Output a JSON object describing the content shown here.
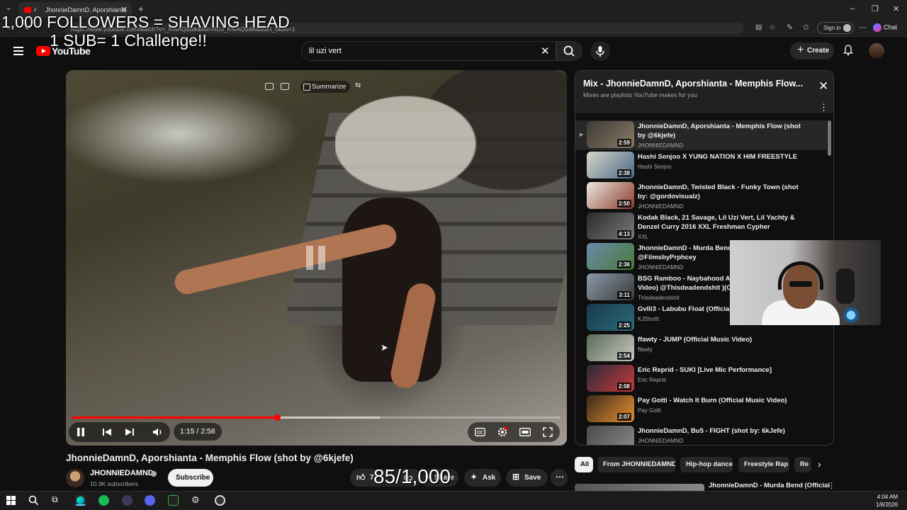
{
  "browser": {
    "tab_title": "JhonnieDamnD, Aporshianta",
    "url": "https://www.youtube.com/watch?v=_Kf4AQddik&list=RDJ_Kf4AQddik&start_radio=1",
    "sign_in": "Sign in",
    "chat": "Chat"
  },
  "stream_overlay": {
    "line1": "1,000 FOLLOWERS = SHAVING HEAD",
    "line2": "1 SUB= 1 Challenge!!",
    "counter": "85/1,000"
  },
  "header": {
    "logo_text": "YouTube",
    "search_value": "lil uzi vert",
    "create_label": "Create"
  },
  "player": {
    "summarize_label": "Summarize",
    "time": "1:15 / 2:58",
    "progress": 0.42,
    "buffered": 0.63
  },
  "video": {
    "title": "JhonnieDamnD, Aporshianta - Memphis Flow (shot by @6kjefe)",
    "channel": "JHONNIEDAMND",
    "subscribers": "10.3K subscribers",
    "subscribe_label": "Subscribe",
    "like_count": "7",
    "share_label": "Share",
    "ask_label": "Ask",
    "save_label": "Save"
  },
  "playlist": {
    "title": "Mix - JhonnieDamnD, Aporshianta - Memphis Flow...",
    "subtitle": "Mixes are playlists YouTube makes for you",
    "items": [
      {
        "title": "JhonnieDamnD, Aporshianta - Memphis Flow (shot by @6kjefe)",
        "channel": "JHONNIEDAMND",
        "duration": "2:59",
        "active": true,
        "colors": [
          "#3d3b35",
          "#8a7a66"
        ]
      },
      {
        "title": "Hashi Senjoo X YUNG NATION X HIM FREESTYLE",
        "channel": "Hashi Senjoo",
        "duration": "2:38",
        "active": false,
        "colors": [
          "#d8d4c8",
          "#4a6a8a"
        ]
      },
      {
        "title": "JhonnieDamnD, Twisted Black - Funky Town (shot by: @gordovisualz)",
        "channel": "JHONNIEDAMND",
        "duration": "2:50",
        "active": false,
        "colors": [
          "#ece8e0",
          "#8a3a2a"
        ]
      },
      {
        "title": "Kodak Black, 21 Savage, Lil Uzi Vert, Lil Yachty & Denzel Curry 2016 XXL Freshman Cypher",
        "channel": "XXL",
        "duration": "4:13",
        "active": false,
        "colors": [
          "#2a2a2a",
          "#7a7a7a"
        ]
      },
      {
        "title": "JhonnieDamnD - Murda Bend (Official Video) @FilmsbyPrphcey",
        "channel": "JHONNIEDAMND",
        "duration": "2:36",
        "active": false,
        "colors": [
          "#6a8aaa",
          "#4a7a3a"
        ]
      },
      {
        "title": "BSG Ramboo - Naybahood Anthem (Official Music Video) @Thisdeadendshit )(Official Music Video)",
        "channel": "Thisdeadendshit",
        "duration": "3:11",
        "active": false,
        "colors": [
          "#8a9aaa",
          "#3a3a3a"
        ]
      },
      {
        "title": "Gvlli3 - Labubu Float (Official Music Video)",
        "channel": "KJShotIt",
        "duration": "2:25",
        "active": false,
        "colors": [
          "#1a3a4a",
          "#2a6a7a"
        ]
      },
      {
        "title": "ffawty - JUMP (Official Music Video)",
        "channel": "ffawty",
        "duration": "2:54",
        "active": false,
        "colors": [
          "#5a6a5a",
          "#c8c8c0"
        ]
      },
      {
        "title": "Eric Reprid - SUKI [Live Mic Performance]",
        "channel": "Eric Reprid",
        "duration": "2:08",
        "active": false,
        "colors": [
          "#2a2a3a",
          "#c83a3a"
        ]
      },
      {
        "title": "Pay Gotti - Watch It Burn (Official Music Video)",
        "channel": "Pay Gotti",
        "duration": "2:07",
        "active": false,
        "colors": [
          "#3a2a1a",
          "#e89030"
        ]
      },
      {
        "title": "JhonnieDamnD, Bu5 - FIGHT (shot by: 6kJefe)",
        "channel": "JHONNIEDAMND",
        "duration": "",
        "active": false,
        "colors": [
          "#4a4a4a",
          "#8a8a8a"
        ]
      }
    ]
  },
  "chips": [
    "All",
    "From JHONNIEDAMND",
    "Hip-hop dance",
    "Freestyle Rap",
    "Re"
  ],
  "recommendation": {
    "title": "JhonnieDamnD - Murda Bend (Official"
  },
  "taskbar": {
    "time": "4:04 AM",
    "date": "1/8/2026"
  },
  "colors": {
    "accent": "#ff0000",
    "background": "#0f0f0f"
  }
}
